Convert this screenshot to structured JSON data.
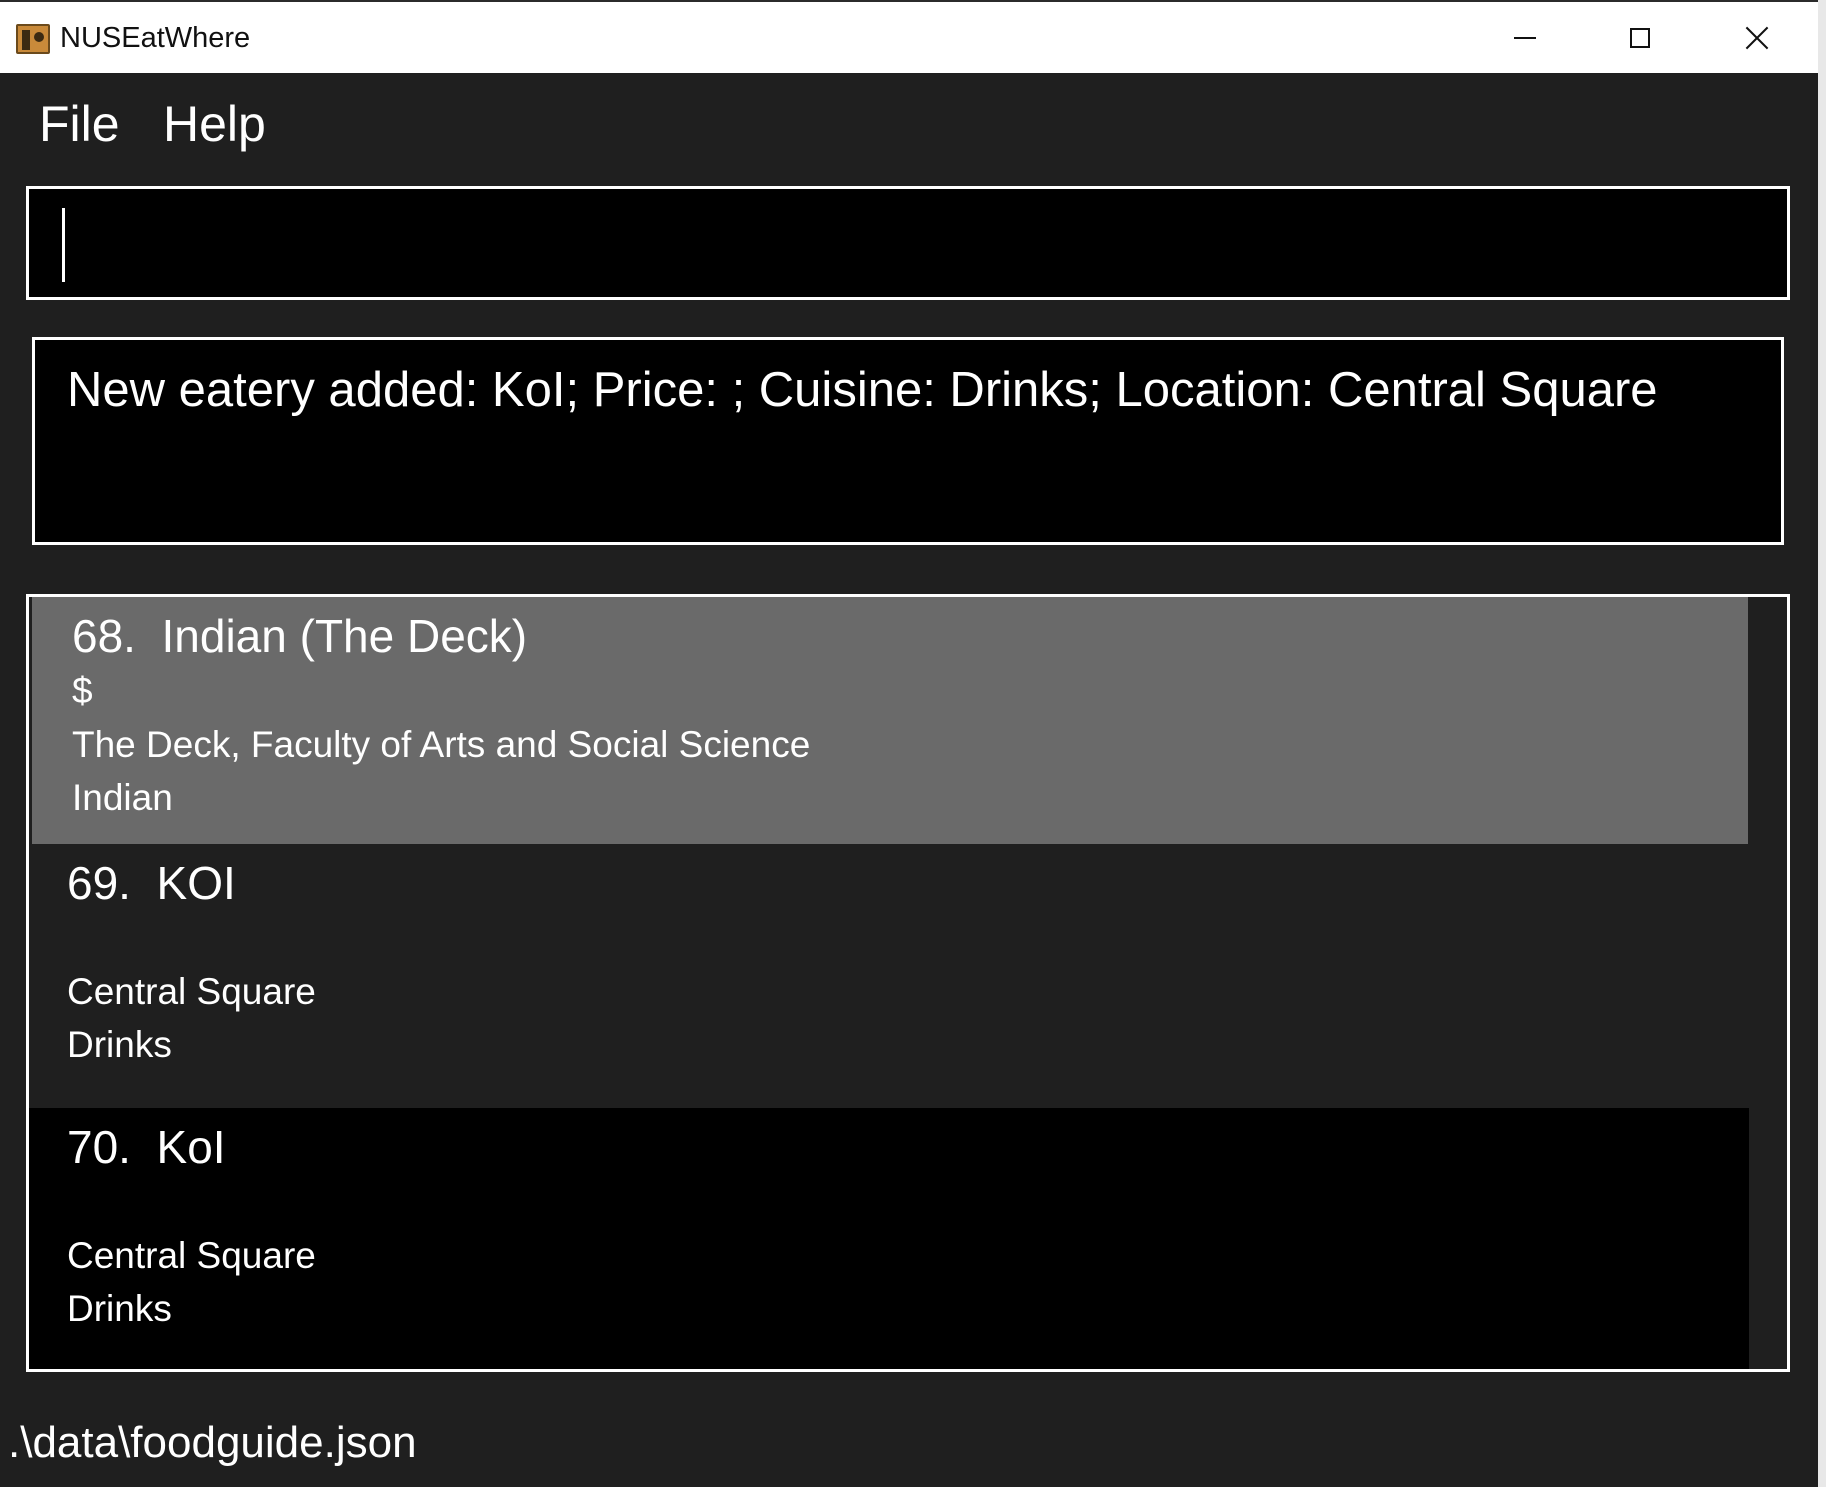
{
  "window": {
    "title": "NUSEatWhere",
    "icon": "address-book-icon",
    "controls": [
      "minimize-icon",
      "maximize-icon",
      "close-icon"
    ]
  },
  "menu": {
    "file": "File",
    "help": "Help"
  },
  "command": {
    "value": "",
    "placeholder": ""
  },
  "result": {
    "message": "New eatery added: KoI; Price: ; Cuisine: Drinks; Location: Central Square"
  },
  "eateries": [
    {
      "index": "68.",
      "name": "Indian (The Deck)",
      "price": "$",
      "location": "The Deck, Faculty of Arts and Social Science",
      "category": "Indian",
      "selected": true
    },
    {
      "index": "69.",
      "name": "KOI",
      "price": "",
      "location": "Central Square",
      "category": "Drinks",
      "selected": false
    },
    {
      "index": "70.",
      "name": "KoI",
      "price": "",
      "location": "Central Square",
      "category": "Drinks",
      "selected": false
    }
  ],
  "status": {
    "file_path": ".\\data\\foodguide.json"
  },
  "colors": {
    "background": "#1f1f1f",
    "selected_card": "#6a6a6a",
    "panel_border": "#ffffff",
    "text": "#ffffff"
  }
}
